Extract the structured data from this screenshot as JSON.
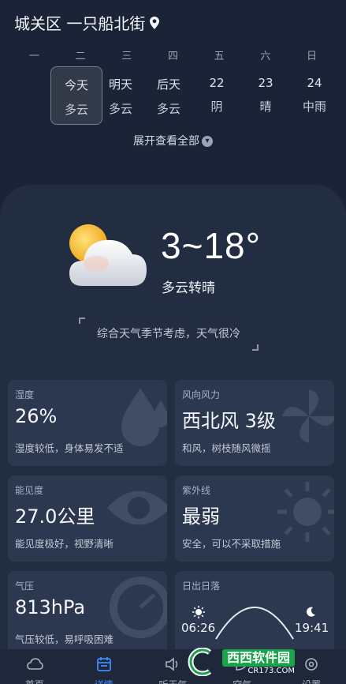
{
  "location": {
    "text": "城关区 一只船北街"
  },
  "week_labels": [
    "一",
    "二",
    "三",
    "四",
    "五",
    "六",
    "日"
  ],
  "days": [
    {
      "day": "今天",
      "weather": "多云"
    },
    {
      "day": "明天",
      "weather": "多云"
    },
    {
      "day": "后天",
      "weather": "多云"
    },
    {
      "day": "22",
      "weather": "阴"
    },
    {
      "day": "23",
      "weather": "晴"
    },
    {
      "day": "24",
      "weather": "中雨"
    }
  ],
  "expand_label": "展开查看全部",
  "current": {
    "temp_range": "3~18°",
    "condition": "多云转晴",
    "advice": "综合天气季节考虑，天气很冷"
  },
  "cards": {
    "humidity": {
      "title": "湿度",
      "value": "26%",
      "desc": "湿度较低，身体易发不适"
    },
    "wind": {
      "title": "风向风力",
      "value": "西北风 3级",
      "desc": "和风，树枝随风微摇"
    },
    "visibility": {
      "title": "能见度",
      "value": "27.0公里",
      "desc": "能见度极好，视野清晰"
    },
    "uv": {
      "title": "紫外线",
      "value": "最弱",
      "desc": "安全，可以不采取措施"
    },
    "pressure": {
      "title": "气压",
      "value": "813hPa",
      "desc": "气压较低，易呼吸困难"
    },
    "sun": {
      "title": "日出日落",
      "sunrise": "06:26",
      "sunset": "19:41"
    }
  },
  "tabs": [
    {
      "label": "首页",
      "icon": "cloud-icon"
    },
    {
      "label": "详情",
      "icon": "calendar-icon"
    },
    {
      "label": "听天气",
      "icon": "speaker-icon"
    },
    {
      "label": "空气",
      "icon": "leaf-icon"
    },
    {
      "label": "设置",
      "icon": "gear-icon"
    }
  ],
  "watermark": {
    "brand": "西西软件园",
    "url": "CR173.COM"
  },
  "colors": {
    "accent": "#3f8bff",
    "background": "#1b2436",
    "card": "#2c3750"
  }
}
